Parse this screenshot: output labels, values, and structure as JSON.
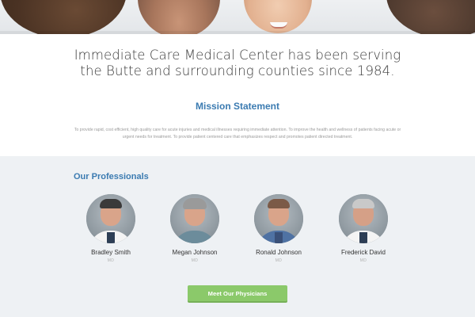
{
  "hero": {
    "image_name": "staff-photo-strip"
  },
  "intro": {
    "heading": "Immediate Care Medical Center has been serving the Butte and surrounding counties since 1984."
  },
  "mission": {
    "title": "Mission Statement",
    "text": "To provide rapid, cost efficient, high quality care for acute injuries and medical illnesses requiring immediate attention. To improve the health and wellness of patients facing acute or urgent needs for treatment. To provide patient centered care that emphasizes respect and promotes patient directed treatment."
  },
  "professionals": {
    "title": "Our Professionals",
    "people": [
      {
        "name": "Bradley Smith",
        "credential": "MD"
      },
      {
        "name": "Megan Johnson",
        "credential": "MD"
      },
      {
        "name": "Ronald Johnson",
        "credential": "MD"
      },
      {
        "name": "Frederick David",
        "credential": "MD"
      }
    ],
    "button_label": "Meet Our Physicians"
  },
  "colors": {
    "accent_blue": "#3b7bb1",
    "button_green": "#8bc96a",
    "section_bg": "#eef1f4"
  }
}
